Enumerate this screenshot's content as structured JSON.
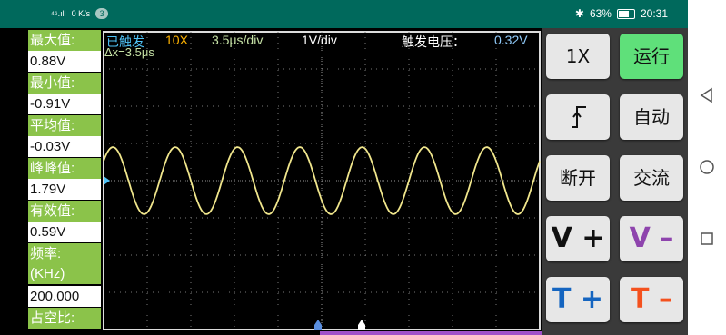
{
  "statusbar": {
    "signal": "⁴⁶.ıll",
    "speed": "0 K/s",
    "notif_count": "3",
    "bluetooth": "✱",
    "battery_pct": "63%",
    "time": "20:31"
  },
  "panel": {
    "max_label": "最大值:",
    "max_value": "0.88V",
    "min_label": "最小值:",
    "min_value": "-0.91V",
    "avg_label": "平均值:",
    "avg_value": "-0.03V",
    "pp_label": "峰峰值:",
    "pp_value": "1.79V",
    "rms_label": "有效值:",
    "rms_value": "0.59V",
    "freq_label": "频率:",
    "freq_unit": "(KHz)",
    "freq_value": "200.000",
    "duty_label": "占空比:"
  },
  "scope": {
    "trigger_status": "已触发",
    "probe": "10X",
    "timebase": "3.5μs/div",
    "voltsdiv": "1V/div",
    "trigger_level_label": "触发电压：",
    "trigger_level_value": "0.32V",
    "delta_x": "Δx=3.5μs",
    "waveform": {
      "shape": "sine",
      "cycles_visible": 7,
      "amplitude_divs": 0.9,
      "color": "#f0e68c"
    },
    "colors": {
      "status": "#4fc3f7",
      "probe": "#ffb300",
      "timebase": "#c5e1a5",
      "voltsdiv": "#ffffff",
      "label": "#ffffff",
      "trigger_value": "#90caf9",
      "cursor": "#4fc3f7"
    }
  },
  "buttons": {
    "probe": "1X",
    "run": "运行",
    "trigger_edge_icon": "rising-edge-icon",
    "auto": "自动",
    "disconnect": "断开",
    "coupling": "交流",
    "v_plus": "V +",
    "v_minus": "V –",
    "t_plus": "T +",
    "t_minus": "T –"
  },
  "colors": {
    "accent_green": "#8bc34a",
    "run_green": "#5fe07a",
    "v_plus": "#111111",
    "v_minus": "#8e44ad",
    "t_plus": "#1565c0",
    "t_minus": "#f4511e",
    "status_bar": "#00695c"
  },
  "navbar": {
    "back": "back-icon",
    "home": "home-icon",
    "recents": "recents-icon"
  }
}
